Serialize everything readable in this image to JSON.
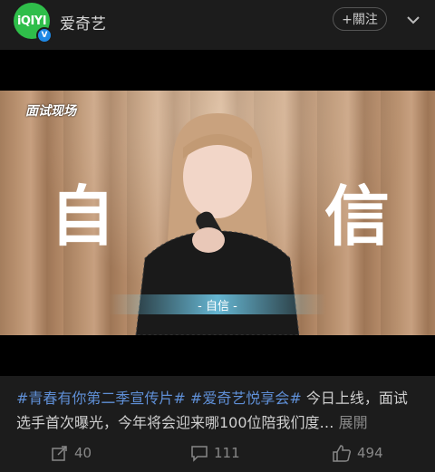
{
  "account": {
    "name": "爱奇艺",
    "logo_text": "iQIYI",
    "verified_badge": "V"
  },
  "header": {
    "follow_label": "+關注",
    "more_icon": "chevron-down-icon"
  },
  "video": {
    "corner_tag": "面试现场",
    "big_char_left": "自",
    "big_char_right": "信",
    "subtitle": "- 自信 -"
  },
  "post": {
    "hashtag1": "#青春有你第二季宣传片#",
    "hashtag2": "#爱奇艺悦享会#",
    "text": "今日上线，面试选手首次曝光，今年将会迎来哪100位陪我们度…",
    "expand_label": "展開"
  },
  "actions": {
    "share_count": "40",
    "comment_count": "111",
    "like_count": "494"
  },
  "colors": {
    "brand_green": "#2fbe4a",
    "hashtag_blue": "#5f8fd6",
    "background": "#1c1c1c"
  }
}
